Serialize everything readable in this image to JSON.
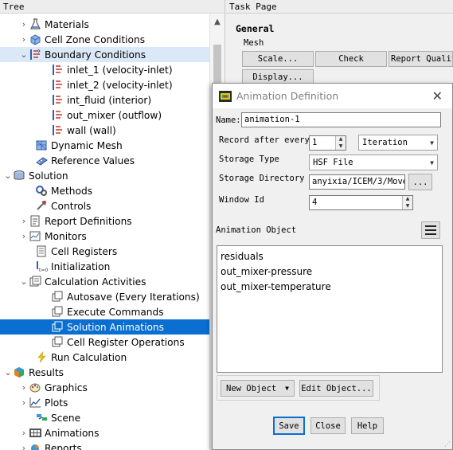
{
  "tree": {
    "header": "Tree",
    "items": [
      {
        "label": "Materials",
        "expander": "›",
        "icon": "flask-icon"
      },
      {
        "label": "Cell Zone Conditions",
        "expander": "›",
        "icon": "cell-zone-icon"
      },
      {
        "label": "Boundary Conditions",
        "expander": "⌄",
        "icon": "boundary-conditions-icon"
      },
      {
        "label": "inlet_1 (velocity-inlet)",
        "expander": "",
        "icon": "boundary-icon"
      },
      {
        "label": "inlet_2 (velocity-inlet)",
        "expander": "",
        "icon": "boundary-icon"
      },
      {
        "label": "int_fluid (interior)",
        "expander": "",
        "icon": "boundary-icon"
      },
      {
        "label": "out_mixer (outflow)",
        "expander": "",
        "icon": "boundary-icon"
      },
      {
        "label": "wall (wall)",
        "expander": "",
        "icon": "boundary-icon"
      },
      {
        "label": "Dynamic Mesh",
        "expander": "",
        "icon": "dynamic-mesh-icon"
      },
      {
        "label": "Reference Values",
        "expander": "",
        "icon": "reference-values-icon"
      },
      {
        "label": "Solution",
        "expander": "⌄",
        "icon": "solution-icon"
      },
      {
        "label": "Methods",
        "expander": "",
        "icon": "methods-icon"
      },
      {
        "label": "Controls",
        "expander": "",
        "icon": "controls-icon"
      },
      {
        "label": "Report Definitions",
        "expander": "›",
        "icon": "report-icon"
      },
      {
        "label": "Monitors",
        "expander": "›",
        "icon": "monitors-icon"
      },
      {
        "label": "Cell Registers",
        "expander": "",
        "icon": "cell-registers-icon"
      },
      {
        "label": "Initialization",
        "expander": "",
        "icon": "initialization-icon"
      },
      {
        "label": "Calculation Activities",
        "expander": "⌄",
        "icon": "calculation-activities-icon"
      },
      {
        "label": "Autosave (Every Iterations)",
        "expander": "",
        "icon": "activity-icon"
      },
      {
        "label": "Execute Commands",
        "expander": "",
        "icon": "activity-icon"
      },
      {
        "label": "Solution Animations",
        "expander": "",
        "icon": "activity-icon"
      },
      {
        "label": "Cell Register Operations",
        "expander": "",
        "icon": "activity-icon"
      },
      {
        "label": "Run Calculation",
        "expander": "",
        "icon": "run-calculation-icon"
      },
      {
        "label": "Results",
        "expander": "⌄",
        "icon": "results-icon"
      },
      {
        "label": "Graphics",
        "expander": "›",
        "icon": "graphics-icon"
      },
      {
        "label": "Plots",
        "expander": "›",
        "icon": "plots-icon"
      },
      {
        "label": "Scene",
        "expander": "",
        "icon": "scene-icon"
      },
      {
        "label": "Animations",
        "expander": "›",
        "icon": "animations-icon"
      },
      {
        "label": "Reports",
        "expander": "›",
        "icon": "reports-icon"
      }
    ]
  },
  "task": {
    "header": "Task Page",
    "title": "General",
    "mesh_label": "Mesh",
    "buttons": {
      "scale": "Scale...",
      "check": "Check",
      "report_quality": "Report Quality",
      "display": "Display..."
    }
  },
  "dialog": {
    "title": "Animation Definition",
    "name_label": "Name:",
    "name_value": "animation-1",
    "record_label": "Record after every",
    "record_value": "1",
    "record_unit": "Iteration",
    "storage_type_label": "Storage Type",
    "storage_type_value": "HSF File",
    "storage_dir_label": "Storage Directory",
    "storage_dir_value": "anyixia/ICEM/3/Move",
    "browse_label": "...",
    "window_id_label": "Window Id",
    "window_id_value": "4",
    "animation_object_label": "Animation Object",
    "objects": [
      "residuals",
      "out_mixer-pressure",
      "out_mixer-temperature"
    ],
    "new_object_label": "New Object",
    "edit_object_label": "Edit Object...",
    "save_label": "Save",
    "close_label": "Close",
    "help_label": "Help"
  }
}
